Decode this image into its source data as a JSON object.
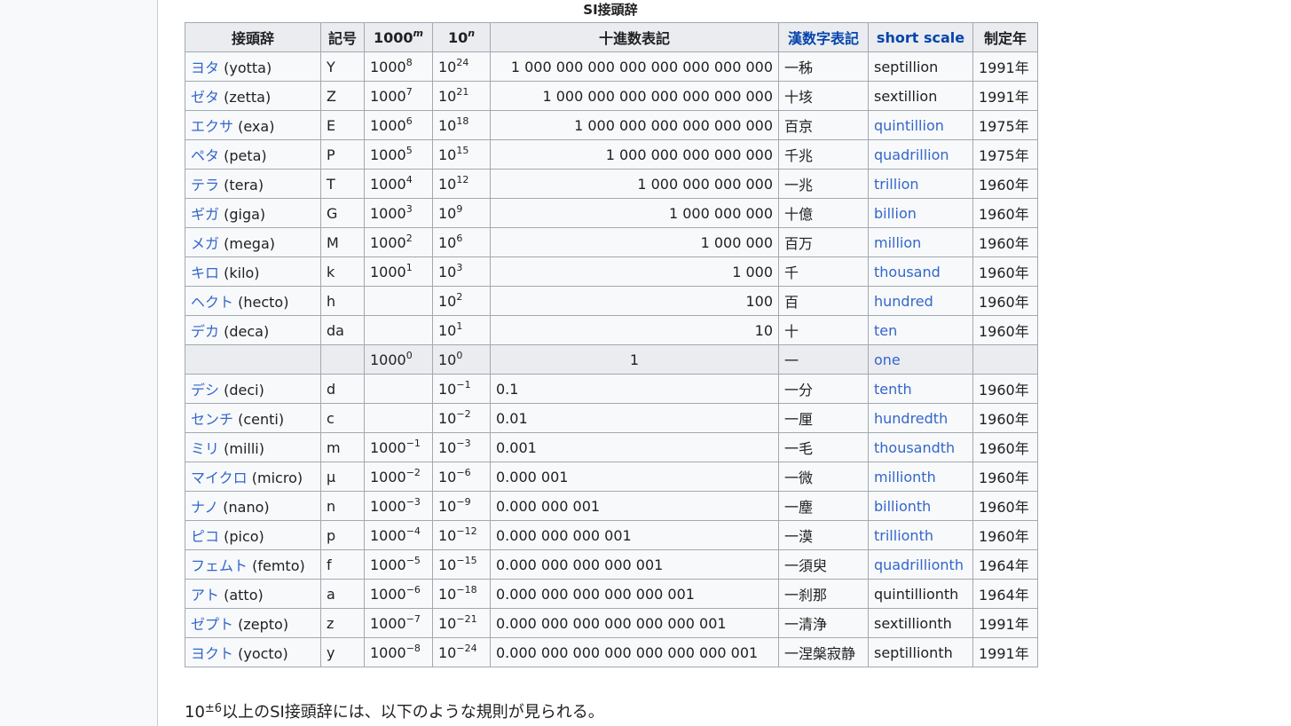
{
  "caption": "SI接頭辞",
  "headers": [
    "接頭辞",
    "記号",
    "1000",
    "10",
    "十進数表記",
    "漢数字表記",
    "short scale",
    "制定年"
  ],
  "header_sups": {
    "thousand": "m",
    "ten": "n"
  },
  "rows": [
    {
      "kana": "ヨタ",
      "roman": "(yotta)",
      "symbol": "Y",
      "pow1000": "8",
      "pow10": "24",
      "decimal": "1 000 000 000 000 000 000 000 000",
      "kanji": "一秭",
      "short": "septillion",
      "short_link": false,
      "year": "1991年"
    },
    {
      "kana": "ゼタ",
      "roman": "(zetta)",
      "symbol": "Z",
      "pow1000": "7",
      "pow10": "21",
      "decimal": "1 000 000 000 000 000 000 000",
      "kanji": "十垓",
      "short": "sextillion",
      "short_link": false,
      "year": "1991年"
    },
    {
      "kana": "エクサ",
      "roman": "(exa)",
      "symbol": "E",
      "pow1000": "6",
      "pow10": "18",
      "decimal": "1 000 000 000 000 000 000",
      "kanji": "百京",
      "short": "quintillion",
      "short_link": true,
      "year": "1975年"
    },
    {
      "kana": "ペタ",
      "roman": "(peta)",
      "symbol": "P",
      "pow1000": "5",
      "pow10": "15",
      "decimal": "1 000 000 000 000 000",
      "kanji": "千兆",
      "short": "quadrillion",
      "short_link": true,
      "year": "1975年"
    },
    {
      "kana": "テラ",
      "roman": "(tera)",
      "symbol": "T",
      "pow1000": "4",
      "pow10": "12",
      "decimal": "1 000 000 000 000",
      "kanji": "一兆",
      "short": "trillion",
      "short_link": true,
      "year": "1960年"
    },
    {
      "kana": "ギガ",
      "roman": "(giga)",
      "symbol": "G",
      "pow1000": "3",
      "pow10": "9",
      "decimal": "1 000 000 000",
      "kanji": "十億",
      "short": "billion",
      "short_link": true,
      "year": "1960年"
    },
    {
      "kana": "メガ",
      "roman": "(mega)",
      "symbol": "M",
      "pow1000": "2",
      "pow10": "6",
      "decimal": "1 000 000",
      "kanji": "百万",
      "short": "million",
      "short_link": true,
      "year": "1960年"
    },
    {
      "kana": "キロ",
      "roman": "(kilo)",
      "symbol": "k",
      "pow1000": "1",
      "pow10": "3",
      "decimal": "1 000",
      "kanji": "千",
      "short": "thousand",
      "short_link": true,
      "year": "1960年"
    },
    {
      "kana": "ヘクト",
      "roman": "(hecto)",
      "symbol": "h",
      "pow1000": "",
      "pow10": "2",
      "decimal": "100",
      "kanji": "百",
      "short": "hundred",
      "short_link": true,
      "year": "1960年"
    },
    {
      "kana": "デカ",
      "roman": "(deca)",
      "symbol": "da",
      "pow1000": "",
      "pow10": "1",
      "decimal": "10",
      "kanji": "十",
      "short": "ten",
      "short_link": true,
      "year": "1960年"
    },
    {
      "kana": "",
      "roman": "",
      "symbol": "",
      "pow1000": "0",
      "pow10": "0",
      "decimal": "1",
      "kanji": "一",
      "short": "one",
      "short_link": true,
      "year": "",
      "unity": true
    },
    {
      "kana": "デシ",
      "roman": "(deci)",
      "symbol": "d",
      "pow1000": "",
      "pow10": "−1",
      "decimal": "0.1",
      "kanji": "一分",
      "short": "tenth",
      "short_link": true,
      "year": "1960年"
    },
    {
      "kana": "センチ",
      "roman": "(centi)",
      "symbol": "c",
      "pow1000": "",
      "pow10": "−2",
      "decimal": "0.01",
      "kanji": "一厘",
      "short": "hundredth",
      "short_link": true,
      "year": "1960年"
    },
    {
      "kana": "ミリ",
      "roman": "(milli)",
      "symbol": "m",
      "pow1000": "−1",
      "pow10": "−3",
      "decimal": "0.001",
      "kanji": "一毛",
      "short": "thousandth",
      "short_link": true,
      "year": "1960年"
    },
    {
      "kana": "マイクロ",
      "roman": "(micro)",
      "symbol": "μ",
      "pow1000": "−2",
      "pow10": "−6",
      "decimal": "0.000 001",
      "kanji": "一微",
      "short": "millionth",
      "short_link": true,
      "year": "1960年"
    },
    {
      "kana": "ナノ",
      "roman": "(nano)",
      "symbol": "n",
      "pow1000": "−3",
      "pow10": "−9",
      "decimal": "0.000 000 001",
      "kanji": "一塵",
      "short": "billionth",
      "short_link": true,
      "year": "1960年"
    },
    {
      "kana": "ピコ",
      "roman": "(pico)",
      "symbol": "p",
      "pow1000": "−4",
      "pow10": "−12",
      "decimal": "0.000 000 000 001",
      "kanji": "一漠",
      "short": "trillionth",
      "short_link": true,
      "year": "1960年"
    },
    {
      "kana": "フェムト",
      "roman": "(femto)",
      "symbol": "f",
      "pow1000": "−5",
      "pow10": "−15",
      "decimal": "0.000 000 000 000 001",
      "kanji": "一須臾",
      "short": "quadrillionth",
      "short_link": true,
      "year": "1964年"
    },
    {
      "kana": "アト",
      "roman": "(atto)",
      "symbol": "a",
      "pow1000": "−6",
      "pow10": "−18",
      "decimal": "0.000 000 000 000 000 001",
      "kanji": "一刹那",
      "short": "quintillionth",
      "short_link": false,
      "year": "1964年"
    },
    {
      "kana": "ゼプト",
      "roman": "(zepto)",
      "symbol": "z",
      "pow1000": "−7",
      "pow10": "−21",
      "decimal": "0.000 000 000 000 000 000 001",
      "kanji": "一清浄",
      "short": "sextillionth",
      "short_link": false,
      "year": "1991年"
    },
    {
      "kana": "ヨクト",
      "roman": "(yocto)",
      "symbol": "y",
      "pow1000": "−8",
      "pow10": "−24",
      "decimal": "0.000 000 000 000 000 000 000 001",
      "kanji": "一涅槃寂静",
      "short": "septillionth",
      "short_link": false,
      "year": "1991年"
    }
  ],
  "base1000": "1000",
  "base10": "10",
  "footer": {
    "base": "10",
    "sup": "±6",
    "text": "以上のSI接頭辞には、以下のような規則が見られる。"
  },
  "colors": {
    "link": "#3366cc",
    "header_link": "#0645ad",
    "border": "#a2a9b1",
    "header_bg": "#eaecf0"
  }
}
